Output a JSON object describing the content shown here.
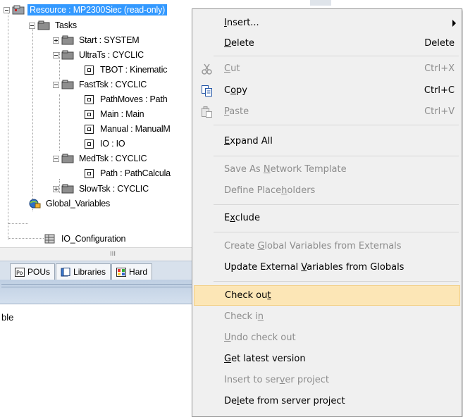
{
  "tree": {
    "root": {
      "label": "Resource : MP2300Siec (read-only)"
    },
    "tasks": {
      "label": "Tasks"
    },
    "items": [
      {
        "key": "start",
        "label": "Start : SYSTEM"
      },
      {
        "key": "ultrats",
        "label": "UltraTs : CYCLIC"
      },
      {
        "key": "tbot",
        "label": "TBOT : Kinematic"
      },
      {
        "key": "fasttsk",
        "label": "FastTsk : CYCLIC"
      },
      {
        "key": "pathmoves",
        "label": "PathMoves : Path"
      },
      {
        "key": "main",
        "label": "Main : Main"
      },
      {
        "key": "manual",
        "label": "Manual : ManualM"
      },
      {
        "key": "io",
        "label": "IO : IO"
      },
      {
        "key": "medtsk",
        "label": "MedTsk : CYCLIC"
      },
      {
        "key": "path",
        "label": "Path : PathCalcula"
      },
      {
        "key": "slowtsk",
        "label": "SlowTsk : CYCLIC"
      }
    ],
    "global_variables": {
      "label": "Global_Variables"
    },
    "io_configuration": {
      "label": "IO_Configuration"
    }
  },
  "scroll_grip": "III",
  "tabs": [
    {
      "label": "POUs",
      "icon": "pou-tab-icon"
    },
    {
      "label": "Libraries",
      "icon": "library-tab-icon"
    },
    {
      "label": "Hard",
      "icon": "hardware-tab-icon"
    }
  ],
  "lower_text": "ble",
  "menu": {
    "insert": {
      "pre": "",
      "u": "I",
      "post": "nsert..."
    },
    "delete": {
      "pre": "",
      "u": "D",
      "post": "elete",
      "shortcut": "Delete"
    },
    "cut": {
      "pre": "",
      "u": "C",
      "post": "ut",
      "shortcut": "Ctrl+X"
    },
    "copy": {
      "pre": "C",
      "u": "o",
      "post": "py",
      "shortcut": "Ctrl+C"
    },
    "paste": {
      "pre": "",
      "u": "P",
      "post": "aste",
      "shortcut": "Ctrl+V"
    },
    "expand_all": {
      "pre": "",
      "u": "E",
      "post": "xpand All"
    },
    "save_as_network_template": {
      "pre": "Save As ",
      "u": "N",
      "post": "etwork Template"
    },
    "define_placeholders": {
      "pre": "Define Place",
      "u": "h",
      "post": "olders"
    },
    "exclude": {
      "pre": "E",
      "u": "x",
      "post": "clude"
    },
    "create_global_vars": {
      "pre": "Create ",
      "u": "G",
      "post": "lobal Variables from Externals"
    },
    "update_external_vars": {
      "pre": "Update External ",
      "u": "V",
      "post": "ariables from Globals"
    },
    "check_out": {
      "pre": "Check ou",
      "u": "t",
      "post": ""
    },
    "check_in": {
      "pre": "Check i",
      "u": "n",
      "post": ""
    },
    "undo_check_out": {
      "pre": "",
      "u": "U",
      "post": "ndo check out"
    },
    "get_latest_version": {
      "pre": "",
      "u": "G",
      "post": "et latest version"
    },
    "insert_to_server": {
      "pre": "Insert to ser",
      "u": "v",
      "post": "er project"
    },
    "delete_from_server": {
      "pre": "De",
      "u": "l",
      "post": "ete from server project"
    }
  },
  "colors": {
    "selection": "#3399ff",
    "menu_background": "#f0f0f0",
    "menu_highlight": "#fce6b6",
    "disabled_text": "#8d8d8d"
  }
}
